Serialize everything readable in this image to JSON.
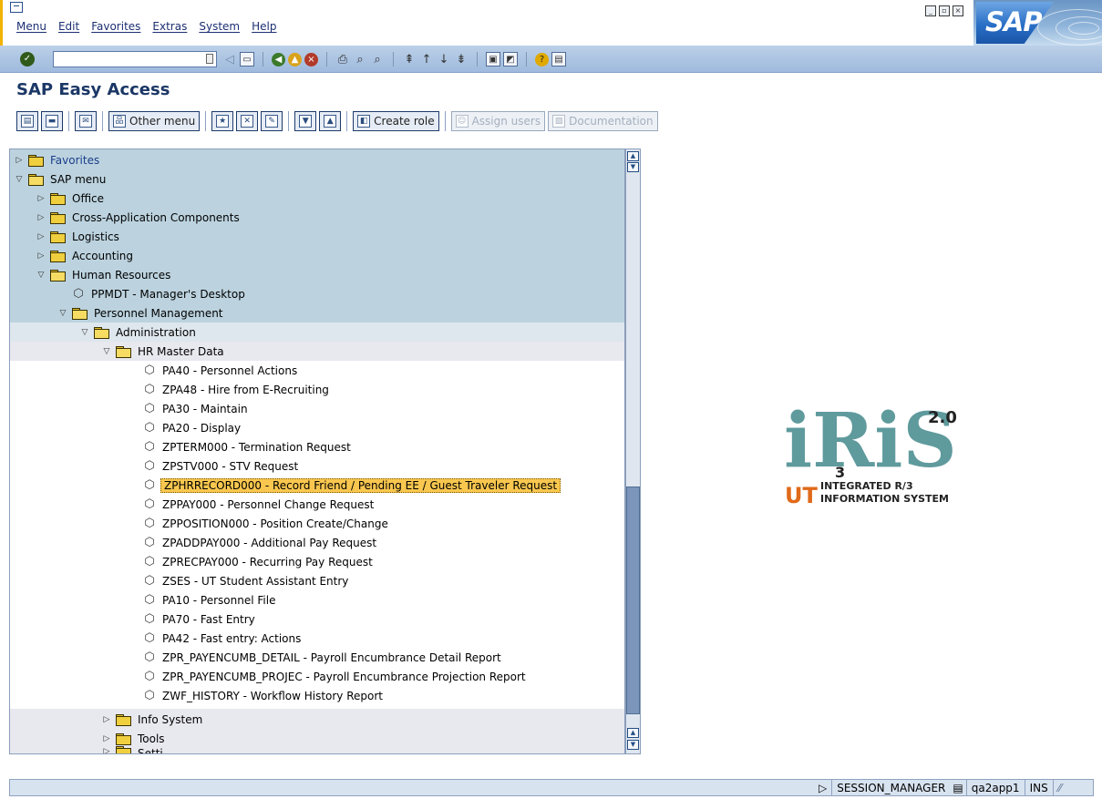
{
  "menubar": {
    "items": [
      "Menu",
      "Edit",
      "Favorites",
      "Extras",
      "System",
      "Help"
    ]
  },
  "brand": {
    "logo_text": "SAP"
  },
  "toolbar": {
    "command_field_value": ""
  },
  "page_title": "SAP Easy Access",
  "app_toolbar": {
    "other_menu": "Other menu",
    "create_role": "Create role",
    "assign_users": "Assign users",
    "documentation": "Documentation"
  },
  "tree": {
    "favorites": "Favorites",
    "sap_menu": "SAP menu",
    "office": "Office",
    "cross_app": "Cross-Application Components",
    "logistics": "Logistics",
    "accounting": "Accounting",
    "human_resources": "Human Resources",
    "ppmdt": "PPMDT - Manager's Desktop",
    "personnel_management": "Personnel Management",
    "administration": "Administration",
    "hr_master_data": "HR Master Data",
    "transactions": [
      "PA40 - Personnel Actions",
      "ZPA48 - Hire from E-Recruiting",
      "PA30 - Maintain",
      "PA20 - Display",
      "ZPTERM000 - Termination Request",
      "ZPSTV000 - STV Request",
      "ZPHRRECORD000 - Record Friend / Pending EE / Guest Traveler Request",
      "ZPPAY000 - Personnel Change Request",
      "ZPPOSITION000 - Position Create/Change",
      "ZPADDPAY000 - Additional Pay Request",
      "ZPRECPAY000 - Recurring Pay Request",
      "ZSES - UT Student Assistant Entry",
      "PA10 - Personnel File",
      "PA70 - Fast Entry",
      "PA42 - Fast entry: Actions",
      "ZPR_PAYENCUMB_DETAIL - Payroll Encumbrance Detail Report",
      "ZPR_PAYENCUMB_PROJEC - Payroll Encumbrance Projection Report",
      "ZWF_HISTORY - Workflow History Report"
    ],
    "info_system": "Info System",
    "tools": "Tools",
    "settings_partial": "Setti..."
  },
  "logo": {
    "main": "iRiS",
    "version": "2.0",
    "sub": "3",
    "ut": "UT",
    "line1": "INTEGRATED R/3",
    "line2": "INFORMATION SYSTEM"
  },
  "statusbar": {
    "program": "SESSION_MANAGER",
    "server": "qa2app1",
    "mode": "INS"
  },
  "colors": {
    "band_blue": "#bcd3df",
    "band_gray": "#e6e6ee",
    "selection": "#f9c74f",
    "title": "#1b3766"
  }
}
